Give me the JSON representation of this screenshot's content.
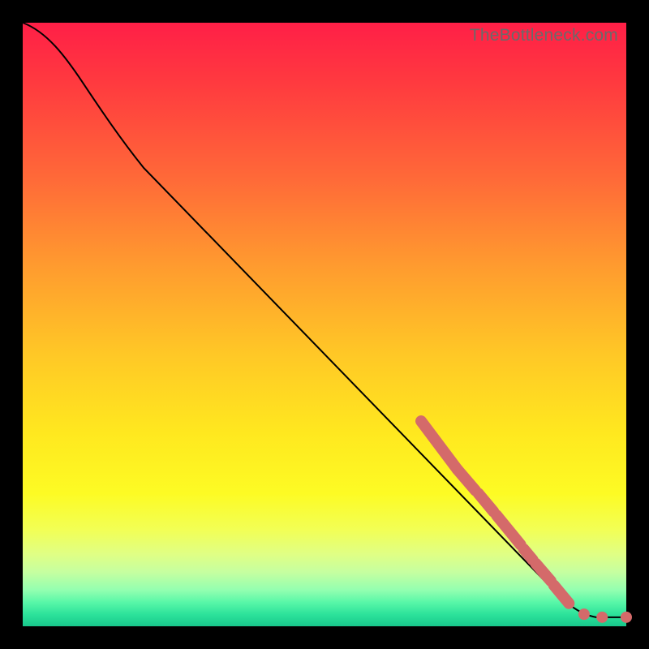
{
  "watermark": "TheBottleneck.com",
  "colors": {
    "marker": "#d46a6a",
    "curve": "#000000"
  },
  "chart_data": {
    "type": "line",
    "title": "",
    "xlabel": "",
    "ylabel": "",
    "xlim": [
      0,
      100
    ],
    "ylim": [
      0,
      100
    ],
    "grid": false,
    "curve": [
      {
        "x": 0,
        "y": 100
      },
      {
        "x": 4,
        "y": 97
      },
      {
        "x": 8,
        "y": 92.5
      },
      {
        "x": 12,
        "y": 87
      },
      {
        "x": 20,
        "y": 76
      },
      {
        "x": 30,
        "y": 63
      },
      {
        "x": 40,
        "y": 50
      },
      {
        "x": 50,
        "y": 37
      },
      {
        "x": 60,
        "y": 25
      },
      {
        "x": 66,
        "y": 34
      },
      {
        "x": 72,
        "y": 26
      },
      {
        "x": 78,
        "y": 19
      },
      {
        "x": 83,
        "y": 12.8
      },
      {
        "x": 87,
        "y": 8
      },
      {
        "x": 90,
        "y": 4.5
      },
      {
        "x": 93,
        "y": 2
      },
      {
        "x": 96,
        "y": 1.5
      },
      {
        "x": 100,
        "y": 1.5
      }
    ],
    "marker_segments": [
      {
        "x1": 66,
        "y1": 34,
        "x2": 72,
        "y2": 26
      },
      {
        "x1": 72,
        "y1": 26,
        "x2": 75,
        "y2": 22.5
      },
      {
        "x1": 75.5,
        "y1": 22,
        "x2": 78,
        "y2": 19
      },
      {
        "x1": 78.5,
        "y1": 18.4,
        "x2": 82.5,
        "y2": 13.5
      },
      {
        "x1": 83,
        "y1": 12.8,
        "x2": 84.5,
        "y2": 11
      },
      {
        "x1": 85,
        "y1": 10.4,
        "x2": 87.5,
        "y2": 7.5
      },
      {
        "x1": 88,
        "y1": 6.8,
        "x2": 90.5,
        "y2": 3.8
      }
    ],
    "marker_points": [
      {
        "x": 93,
        "y": 2
      },
      {
        "x": 96,
        "y": 1.5
      },
      {
        "x": 100,
        "y": 1.5
      }
    ]
  }
}
